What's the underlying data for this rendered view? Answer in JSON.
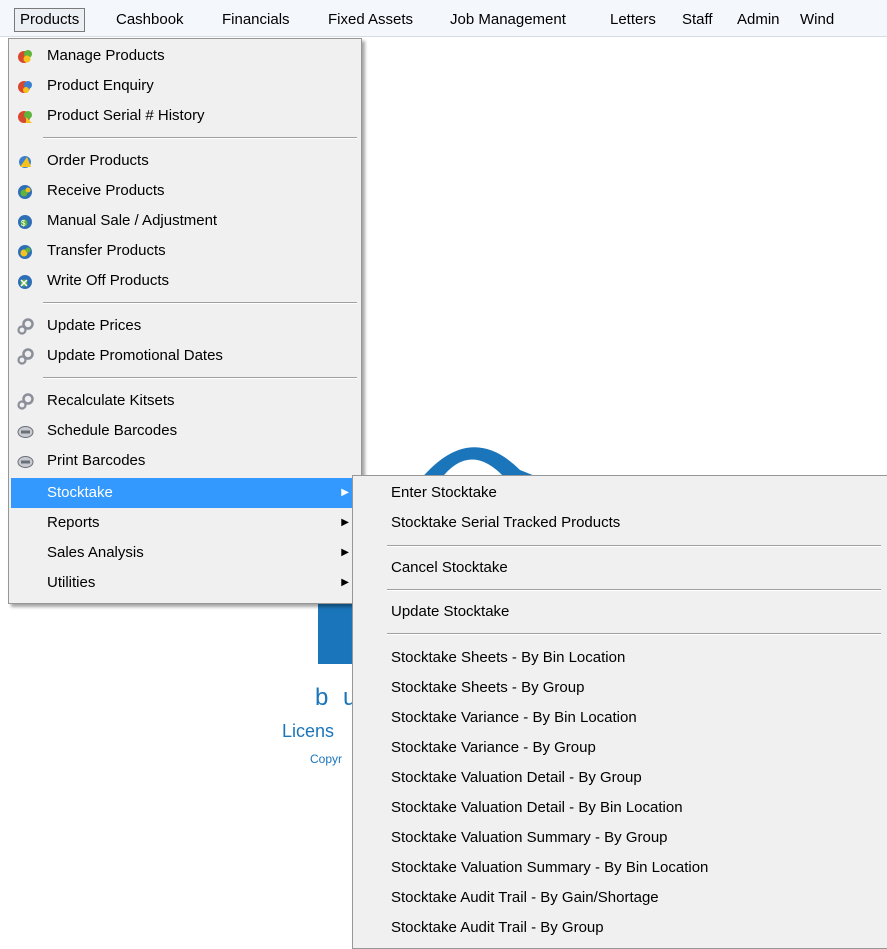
{
  "menubar": {
    "items": [
      "Products",
      "Cashbook",
      "Financials",
      "Fixed Assets",
      "Job Management",
      "Letters",
      "Staff",
      "Admin",
      "Wind"
    ]
  },
  "background": {
    "logo_line1": "b u",
    "logo_line2": "Licens",
    "logo_line3": "Copyr",
    "logo_letter": "In"
  },
  "products_menu": {
    "items": [
      {
        "label": "Manage Products",
        "icon": "manage-products-icon"
      },
      {
        "label": "Product Enquiry",
        "icon": "product-enquiry-icon"
      },
      {
        "label": "Product Serial # History",
        "icon": "serial-history-icon"
      },
      {
        "label": "Order Products",
        "icon": "order-products-icon"
      },
      {
        "label": "Receive Products",
        "icon": "receive-products-icon"
      },
      {
        "label": "Manual Sale / Adjustment",
        "icon": "manual-sale-icon"
      },
      {
        "label": "Transfer Products",
        "icon": "transfer-products-icon"
      },
      {
        "label": "Write Off Products",
        "icon": "write-off-icon"
      },
      {
        "label": "Update Prices",
        "icon": "gears-icon"
      },
      {
        "label": "Update Promotional Dates",
        "icon": "gears-icon"
      },
      {
        "label": "Recalculate Kitsets",
        "icon": "gears-icon"
      },
      {
        "label": "Schedule Barcodes",
        "icon": "barcode-icon"
      },
      {
        "label": "Print Barcodes",
        "icon": "barcode-icon"
      },
      {
        "label": "Stocktake",
        "submenu": true
      },
      {
        "label": "Reports",
        "submenu": true
      },
      {
        "label": "Sales Analysis",
        "submenu": true
      },
      {
        "label": "Utilities",
        "submenu": true
      }
    ]
  },
  "stocktake_menu": {
    "items": [
      "Enter Stocktake",
      "Stocktake Serial Tracked Products",
      "Cancel Stocktake",
      "Update Stocktake",
      "Stocktake Sheets - By Bin Location",
      "Stocktake Sheets - By Group",
      "Stocktake Variance - By Bin Location",
      "Stocktake Variance - By Group",
      "Stocktake Valuation Detail - By Group",
      "Stocktake Valuation Detail - By Bin Location",
      "Stocktake Valuation Summary - By Group",
      "Stocktake Valuation Summary - By Bin Location",
      "Stocktake Audit Trail - By Gain/Shortage",
      "Stocktake Audit Trail - By Group"
    ]
  },
  "colors": {
    "selection": "#3399ff",
    "logo_blue": "#1b75bb"
  }
}
